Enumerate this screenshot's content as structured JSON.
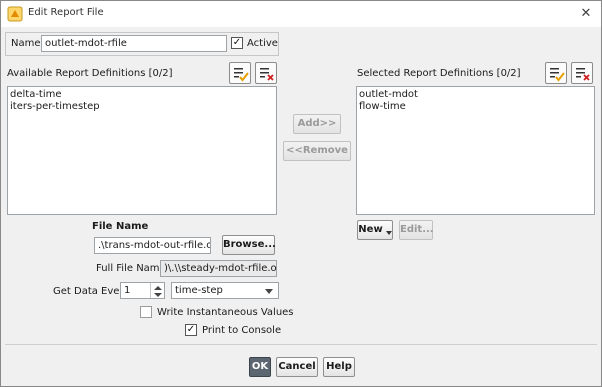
{
  "window": {
    "title": "Edit Report File",
    "close_icon": "close-icon",
    "app_icon": "fluent-app-icon"
  },
  "name_row": {
    "label": "Name",
    "value": "outlet-mdot-rfile",
    "active_label": "Active",
    "active_checked": true
  },
  "available": {
    "heading": "Available Report Definitions [0/2]",
    "items": [
      "delta-time",
      "iters-per-timestep"
    ],
    "select_all_icon": "select-all-icon",
    "deselect_all_icon": "deselect-all-icon"
  },
  "selected": {
    "heading": "Selected Report Definitions [0/2]",
    "items": [
      "outlet-mdot",
      "flow-time"
    ],
    "select_all_icon": "select-all-icon",
    "deselect_all_icon": "deselect-all-icon"
  },
  "buttons": {
    "add": "Add>>",
    "remove": "<<Remove",
    "new": "New",
    "edit": "Edit...",
    "browse": "Browse...",
    "ok": "OK",
    "cancel": "Cancel",
    "help": "Help"
  },
  "file": {
    "heading": "File Name",
    "file_name_value": ".\\trans-mdot-out-rfile.out",
    "full_label": "Full File Name",
    "full_value": ")\\.\\\\steady-mdot-rfile.out"
  },
  "get_data": {
    "label": "Get Data Every",
    "value": "1",
    "unit_option": "time-step"
  },
  "options": {
    "write_instantaneous": {
      "label": "Write Instantaneous Values",
      "checked": false
    },
    "print_console": {
      "label": "Print to Console",
      "checked": true
    }
  },
  "colors": {
    "ok_button_bg": "#5b6670",
    "dialog_bg": "#f0f0f0",
    "icon_accent": "#e5a000",
    "icon_red": "#d02020"
  }
}
